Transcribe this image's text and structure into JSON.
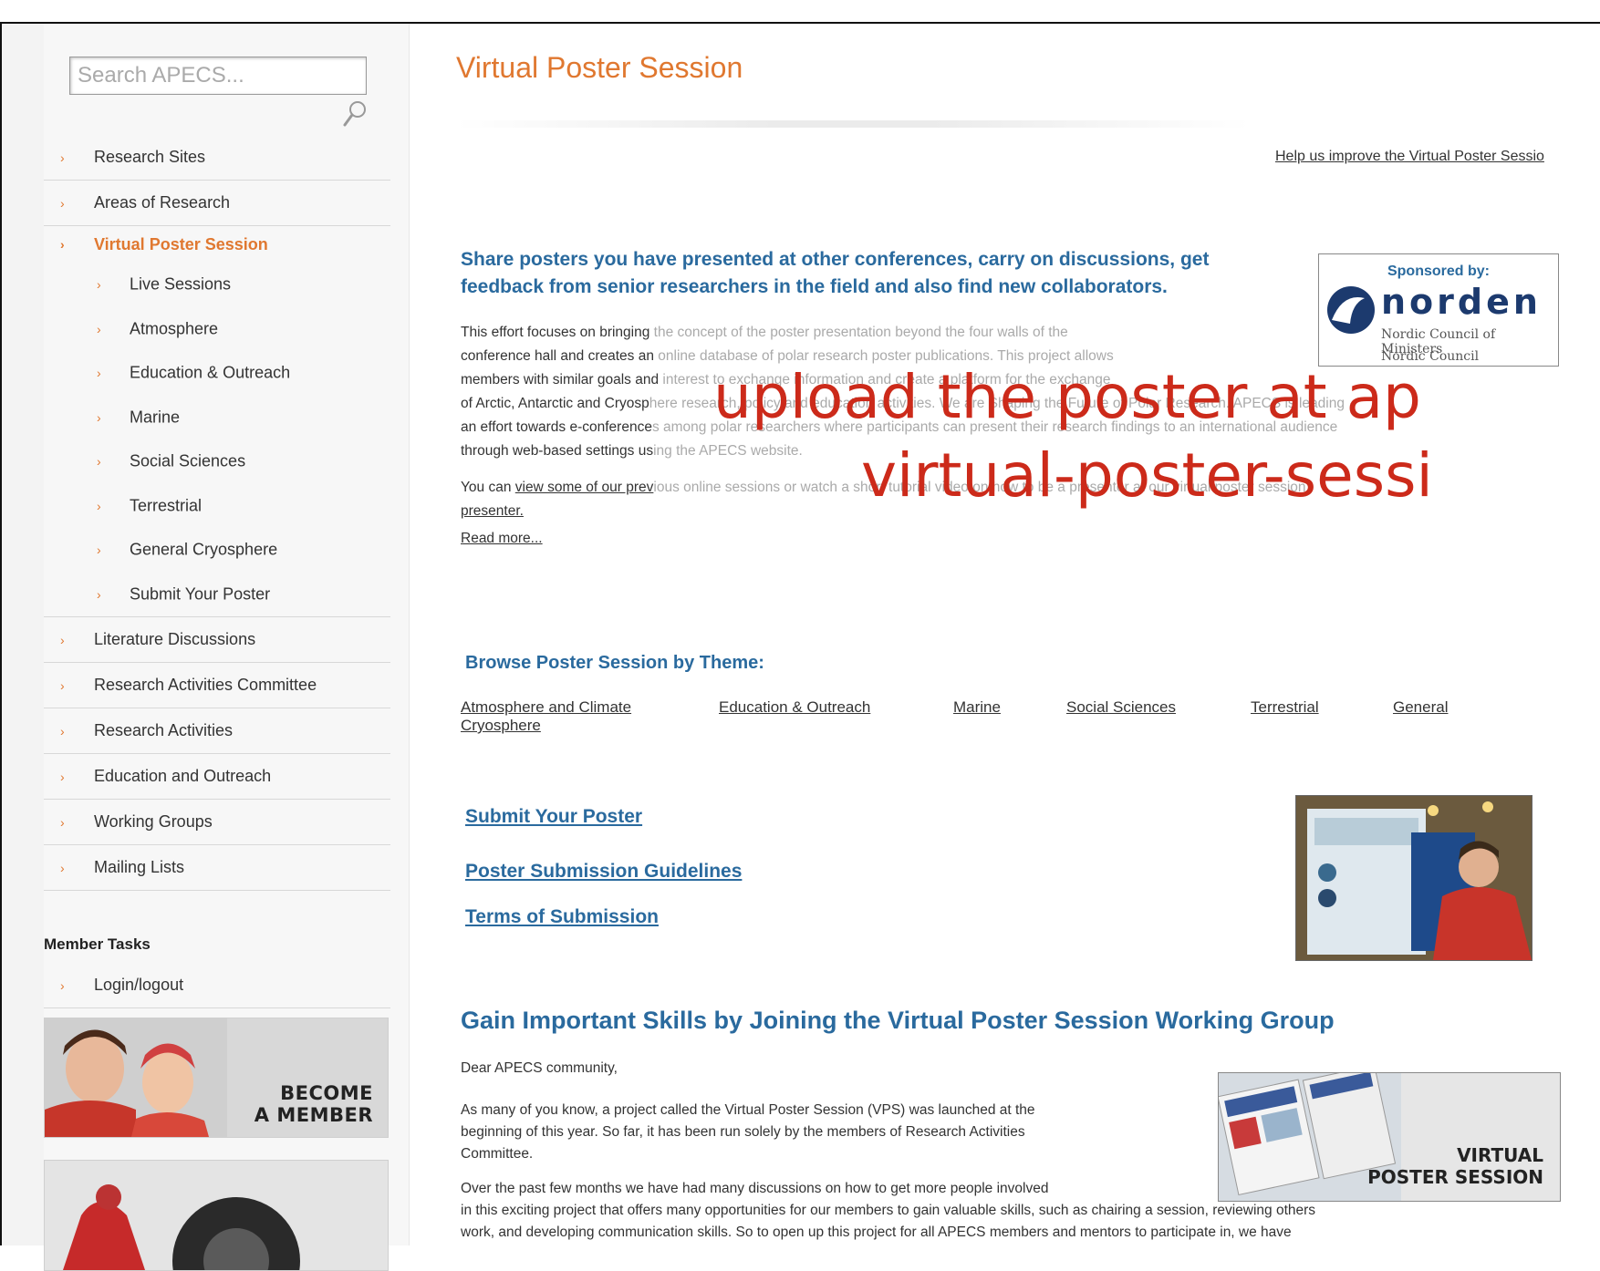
{
  "search": {
    "placeholder": "Search APECS..."
  },
  "nav": {
    "items_top": [
      "Research Sites",
      "Areas of Research"
    ],
    "active": "Virtual Poster Session",
    "sub_items": [
      "Live Sessions",
      "Atmosphere",
      "Education & Outreach",
      "Marine",
      "Social Sciences",
      "Terrestrial",
      "General Cryosphere",
      "Submit Your Poster"
    ],
    "items_bottom": [
      "Literature Discussions",
      "Research Activities Committee",
      "Research Activities",
      "Education and Outreach",
      "Working Groups",
      "Mailing Lists"
    ],
    "member_tasks_title": "Member Tasks",
    "login": "Login/logout",
    "arrow_glyph": "›"
  },
  "banners": {
    "become_line1": "BECOME",
    "become_line2": "A MEMBER"
  },
  "main": {
    "title": "Virtual Poster Session",
    "help_link": "Help us improve the Virtual Poster Sessio",
    "intro_heading": "Share posters you have presented at other conferences, carry on discussions, get feedback from senior researchers in the field and also find new collaborators.",
    "sponsor": {
      "by": "Sponsored by:",
      "brand": "norden",
      "line1": "Nordic Council of Ministers",
      "line2": "Nordic Council"
    },
    "paragraph1": {
      "l1a": "This effort focuses on bringing",
      "l1b": " the concept of the poster presentation beyond the four walls of the",
      "l2a": "conference hall and creates an",
      "l2b": " online database of polar research poster publications. This project allows",
      "l3a": "members with similar goals and",
      "l3b": " interest to exchange information and create a platform for the exchange",
      "l4a": "of Arctic, Antarctic and Cryosp",
      "l4b": "here research, policy and education activities. We are Shaping the Future of Polar Research. APECS is leading",
      "l5a": "an effort towards e-conference",
      "l5b": "s among polar researchers where participants can present their research findings to an international audience",
      "l6a": "through web-based settings us",
      "l6b": "ing the APECS website."
    },
    "paragraph2": {
      "prefix": "You can ",
      "link1": "view some of our prev",
      "faint": "ious online sessions",
      "rest": " or watch a short tutorial video on how to be a presenter at our virtual poster session",
      "end": "presenter."
    },
    "read_more": "Read more...",
    "overlay_line1": "upload the poster at ap",
    "overlay_line2": "virtual-poster-sessi",
    "browse_heading": "Browse Poster Session by Theme:",
    "themes": [
      "Atmosphere and Climate",
      "Cryosphere",
      "Education & Outreach",
      "Marine",
      "Social Sciences",
      "Terrestrial",
      "General"
    ],
    "submit_link": "Submit Your Poster",
    "guidelines_link": "Poster Submission Guidelines",
    "terms_link": "Terms of Submission",
    "gain_heading": "Gain Important Skills by Joining the Virtual Poster Session Working Group",
    "dear": "Dear APECS community,",
    "para_a1": "As many of you know, a project called the Virtual Poster Session (VPS) was launched at the",
    "para_a2": "beginning of this year. So far, it has been run solely by the members of Research Activities",
    "para_a3": "Committee.",
    "para_b1": "Over the past few months we have had many discussions on how to get more people involved",
    "para_b2": "in this exciting project that offers many opportunities for our members to gain valuable skills, such as chairing a session, reviewing others",
    "para_b3": "work, and developing communication skills. So to open up this project for all APECS members and mentors to participate in, we have",
    "vps_banner_line1": "VIRTUAL",
    "vps_banner_line2": "POSTER SESSION"
  },
  "colors": {
    "accent_orange": "#e07830",
    "link_blue": "#2a6a9e",
    "overlay_red": "#cc2a1a"
  }
}
